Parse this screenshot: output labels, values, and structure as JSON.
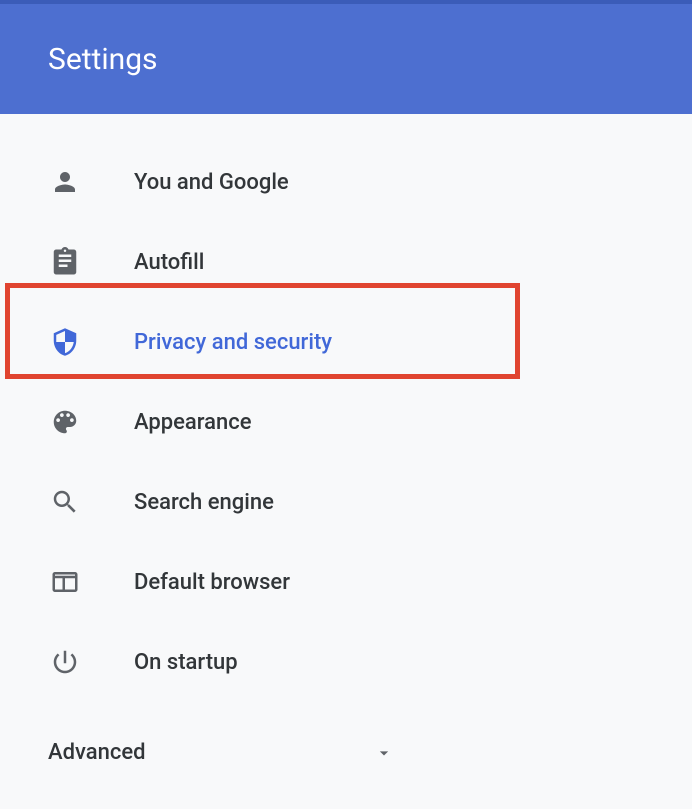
{
  "header": {
    "title": "Settings"
  },
  "nav": {
    "items": [
      {
        "label": "You and Google",
        "icon": "person"
      },
      {
        "label": "Autofill",
        "icon": "clipboard"
      },
      {
        "label": "Privacy and security",
        "icon": "shield",
        "selected": true
      },
      {
        "label": "Appearance",
        "icon": "palette"
      },
      {
        "label": "Search engine",
        "icon": "search"
      },
      {
        "label": "Default browser",
        "icon": "browser"
      },
      {
        "label": "On startup",
        "icon": "power"
      }
    ]
  },
  "advanced": {
    "label": "Advanced"
  }
}
